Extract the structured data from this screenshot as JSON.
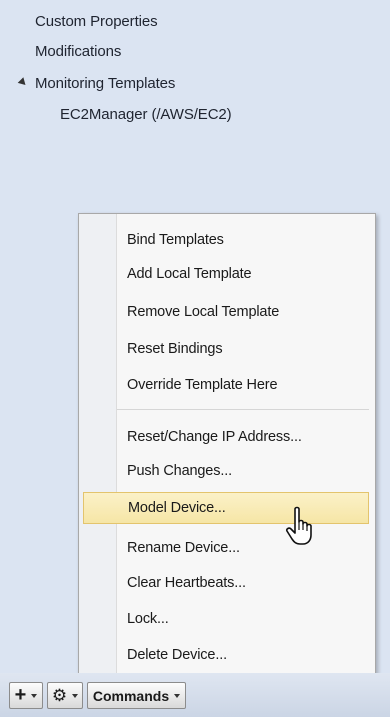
{
  "tree": {
    "items": [
      {
        "label": "Custom Properties"
      },
      {
        "label": "Modifications"
      },
      {
        "label": "Monitoring Templates"
      },
      {
        "label": "EC2Manager (/AWS/EC2)"
      }
    ]
  },
  "menu": {
    "items": [
      {
        "label": "Bind Templates"
      },
      {
        "label": "Add Local Template"
      },
      {
        "label": "Remove Local Template"
      },
      {
        "label": "Reset Bindings"
      },
      {
        "label": "Override Template Here"
      },
      {
        "label": "Reset/Change IP Address..."
      },
      {
        "label": "Push Changes..."
      },
      {
        "label": "Model Device..."
      },
      {
        "label": "Rename Device..."
      },
      {
        "label": "Clear Heartbeats..."
      },
      {
        "label": "Lock..."
      },
      {
        "label": "Delete Device..."
      }
    ],
    "highlighted_index": 7
  },
  "toolbar": {
    "add_icon": "plus-icon",
    "gear_icon": "gear-icon",
    "commands_label": "Commands"
  },
  "colors": {
    "background": "#dbe4f2",
    "highlight": "#f6e6a6"
  }
}
